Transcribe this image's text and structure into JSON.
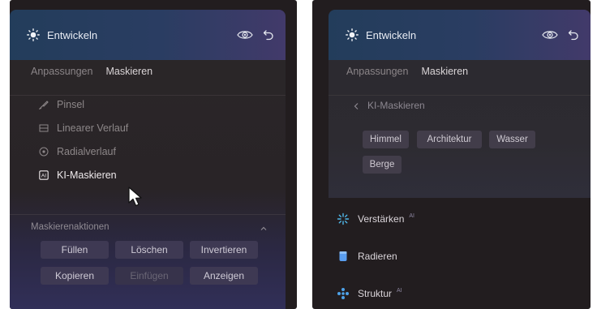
{
  "left": {
    "header": {
      "title": "Entwickeln"
    },
    "tabs": [
      "Anpassungen",
      "Maskieren"
    ],
    "tools": [
      {
        "label": "Pinsel",
        "icon": "brush-icon"
      },
      {
        "label": "Linearer Verlauf",
        "icon": "linear-gradient-icon"
      },
      {
        "label": "Radialverlauf",
        "icon": "radial-gradient-icon"
      },
      {
        "label": "KI-Maskieren",
        "icon": "ai-mask-icon"
      }
    ],
    "mask_actions": {
      "title": "Maskierenaktionen",
      "buttons": [
        "Füllen",
        "Löschen",
        "Invertieren",
        "Kopieren",
        "Einfügen",
        "Anzeigen"
      ]
    }
  },
  "right": {
    "header": {
      "title": "Entwickeln"
    },
    "tabs": [
      "Anpassungen",
      "Maskieren"
    ],
    "back_label": "KI-Maskieren",
    "chips": [
      "Himmel",
      "Architektur",
      "Wasser",
      "Berge"
    ],
    "features": [
      {
        "label": "Verstärken",
        "badge": "AI",
        "icon": "sparkle-icon",
        "color": "#4fb7e8"
      },
      {
        "label": "Radieren",
        "badge": "",
        "icon": "eraser-icon",
        "color": "#5a9ef0"
      },
      {
        "label": "Struktur",
        "badge": "AI",
        "icon": "structure-icon",
        "color": "#4ea2e8"
      }
    ]
  },
  "colors": {
    "accent": "#2a3d62",
    "text": "#e8ecf4"
  }
}
